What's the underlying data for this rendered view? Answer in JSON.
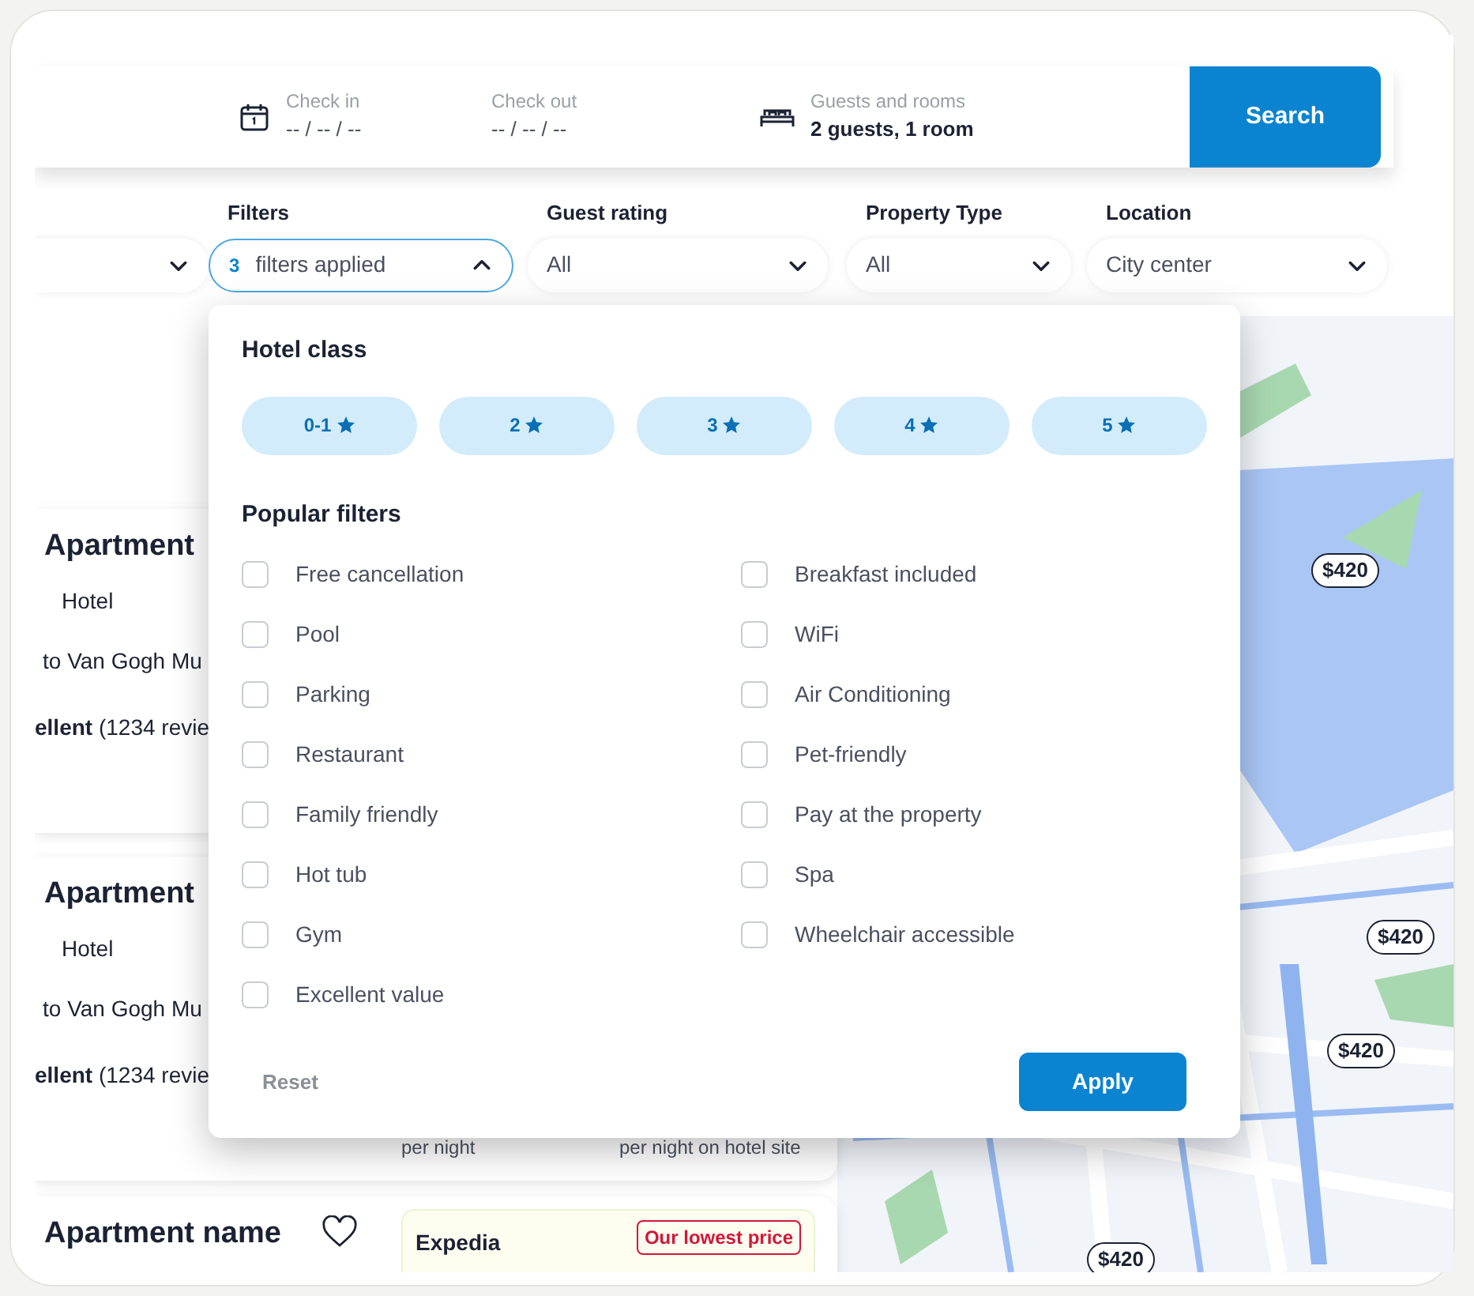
{
  "search_bar": {
    "check_in": {
      "label": "Check in",
      "value": "-- / -- / --"
    },
    "check_out": {
      "label": "Check out",
      "value": "-- / -- / --"
    },
    "guests": {
      "label": "Guests and rooms",
      "value": "2 guests, 1 room"
    },
    "button": "Search"
  },
  "filter_bar": [
    {
      "kind": "cut"
    },
    {
      "kind": "count",
      "label": "Filters",
      "count": "3",
      "value": "filters applied",
      "expanded": true
    },
    {
      "kind": "select",
      "label": "Guest rating",
      "value": "All",
      "expanded": false
    },
    {
      "kind": "select",
      "label": "Property Type",
      "value": "All",
      "expanded": false
    },
    {
      "kind": "select",
      "label": "Location",
      "value": "City center",
      "expanded": false
    }
  ],
  "listings": [
    {
      "title": "Apartment",
      "type": "Hotel",
      "distance": "to Van Gogh Mu",
      "rating": "**ellent** (1234 revie"
    },
    {
      "title": "Apartment",
      "type": "Hotel",
      "distance": "to Van Gogh Mu",
      "rating": "**ellent** (1234 revie",
      "prices": [
        "per night",
        "per night on hotel site"
      ]
    },
    {
      "title": "Apartment name",
      "favorite": false,
      "provider": "Expedia",
      "badge": "Our lowest price"
    }
  ],
  "map": {
    "kind": "picture",
    "pins": [
      "$420",
      "$420",
      "$420",
      "$420"
    ]
  },
  "filters_panel": {
    "hotel_class_title": "Hotel class",
    "hotel_classes": [
      "0-1",
      "2",
      "3",
      "4",
      "5"
    ],
    "popular_title": "Popular filters",
    "popular": [
      {
        "label": "Free cancellation",
        "checked": false
      },
      {
        "label": "Breakfast included",
        "checked": false
      },
      {
        "label": "Pool",
        "checked": false
      },
      {
        "label": "WiFi",
        "checked": false
      },
      {
        "label": "Parking",
        "checked": false
      },
      {
        "label": "Air Conditioning",
        "checked": false
      },
      {
        "label": "Restaurant",
        "checked": false
      },
      {
        "label": "Pet-friendly",
        "checked": false
      },
      {
        "label": "Family friendly",
        "checked": false
      },
      {
        "label": "Pay at the property",
        "checked": false
      },
      {
        "label": "Hot tub",
        "checked": false
      },
      {
        "label": "Spa",
        "checked": false
      },
      {
        "label": "Gym",
        "checked": false
      },
      {
        "label": "Wheelchair accessible",
        "checked": false
      },
      {
        "label": "Excellent value",
        "checked": false
      }
    ],
    "reset": "Reset",
    "apply": "Apply"
  }
}
